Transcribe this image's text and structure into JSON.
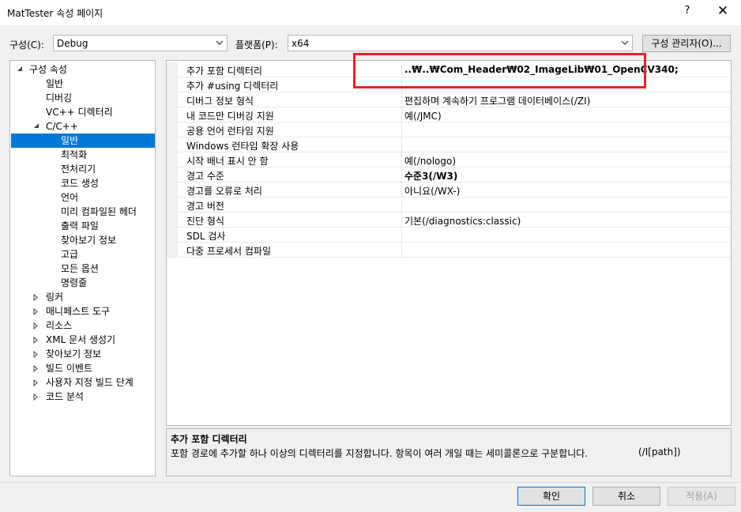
{
  "window": {
    "title": "MatTester 속성 페이지",
    "help_label": "?",
    "close_label": "✕"
  },
  "toolbar": {
    "config_label": "구성(C):",
    "config_value": "Debug",
    "platform_label": "플랫폼(P):",
    "platform_value": "x64",
    "config_manager_label": "구성 관리자(O)..."
  },
  "tree": {
    "items": [
      {
        "label": "구성 속성"
      },
      {
        "label": "일반"
      },
      {
        "label": "디버깅"
      },
      {
        "label": "VC++ 디렉터리"
      },
      {
        "label": "C/C++"
      },
      {
        "label": "일반"
      },
      {
        "label": "최적화"
      },
      {
        "label": "전처리기"
      },
      {
        "label": "코드 생성"
      },
      {
        "label": "언어"
      },
      {
        "label": "미리 컴파일된 헤더"
      },
      {
        "label": "출력 파일"
      },
      {
        "label": "찾아보기 정보"
      },
      {
        "label": "고급"
      },
      {
        "label": "모든 옵션"
      },
      {
        "label": "명령줄"
      },
      {
        "label": "링커"
      },
      {
        "label": "매니페스트 도구"
      },
      {
        "label": "리소스"
      },
      {
        "label": "XML 문서 생성기"
      },
      {
        "label": "찾아보기 정보"
      },
      {
        "label": "빌드 이벤트"
      },
      {
        "label": "사용자 지정 빌드 단계"
      },
      {
        "label": "코드 분석"
      }
    ]
  },
  "grid": {
    "rows": [
      {
        "name": "추가 포함 디렉터리",
        "value": "..₩..₩Com_Header₩02_ImageLib₩01_OpenCV340;"
      },
      {
        "name": "추가 #using 디렉터리",
        "value": ""
      },
      {
        "name": "디버그 정보 형식",
        "value": "편집하며 계속하기 프로그램 데이터베이스(/ZI)"
      },
      {
        "name": "내 코드만 디버깅 지원",
        "value": "예(/JMC)"
      },
      {
        "name": "공용 언어 런타임 지원",
        "value": ""
      },
      {
        "name": "Windows 런타임 확장 사용",
        "value": ""
      },
      {
        "name": "시작 배너 표시 안 함",
        "value": "예(/nologo)"
      },
      {
        "name": "경고 수준",
        "value": "수준3(/W3)"
      },
      {
        "name": "경고를 오류로 처리",
        "value": "아니요(/WX-)"
      },
      {
        "name": "경고 버전",
        "value": ""
      },
      {
        "name": "진단 형식",
        "value": "기본(/diagnostics:classic)"
      },
      {
        "name": "SDL 검사",
        "value": ""
      },
      {
        "name": "다중 프로세서 컴파일",
        "value": ""
      }
    ]
  },
  "description": {
    "title": "추가 포함 디렉터리",
    "text": "포함 경로에 추가할 하나 이상의 디렉터리를 지정합니다. 항목이 여러 개일 때는 세미콜론으로 구분합니다.",
    "switch": "(/I[path])"
  },
  "buttons": {
    "ok": "확인",
    "cancel": "취소",
    "apply": "적용(A)"
  },
  "colors": {
    "selection": "#0078d7",
    "highlight_box": "#e5232b"
  }
}
